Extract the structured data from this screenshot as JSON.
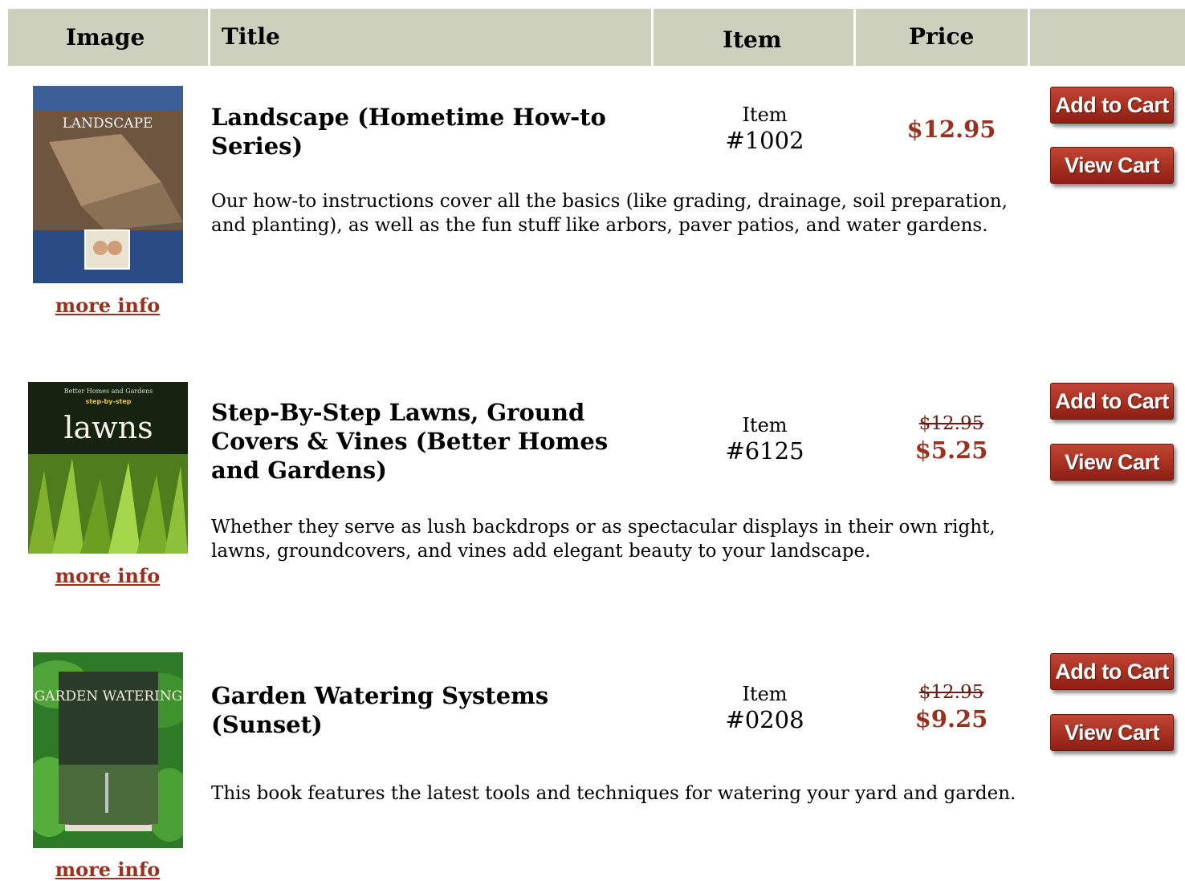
{
  "header": {
    "image": "Image",
    "title": "Title",
    "item": "Item",
    "price": "Price"
  },
  "common": {
    "more_info": "more info",
    "item_label": "Item",
    "add_to_cart": "Add to Cart",
    "view_cart": "View Cart"
  },
  "products": [
    {
      "title": "Landscape (Hometime How-to Series)",
      "description": "Our how-to instructions cover all the basics (like grading, drainage, soil preparation, and planting), as well as the fun stuff like arbors, paver patios, and water gardens.",
      "item_number": "#1002",
      "old_price": "",
      "price": "$12.95",
      "cover_text": "LANDSCAPE"
    },
    {
      "title": "Step-By-Step Lawns, Ground Covers & Vines (Better Homes and Gardens)",
      "description": "Whether they serve as lush backdrops or as spectacular displays in their own right, lawns, groundcovers, and vines add elegant beauty to your landscape.",
      "item_number": "#6125",
      "old_price": "$12.95",
      "price": "$5.25",
      "cover_text": "lawns"
    },
    {
      "title": "Garden Watering Systems (Sunset)",
      "description": "This book features the latest tools and techniques for watering your yard and garden.",
      "item_number": "#0208",
      "old_price": "$12.95",
      "price": "$9.25",
      "cover_text": "GARDEN WATERING"
    }
  ]
}
